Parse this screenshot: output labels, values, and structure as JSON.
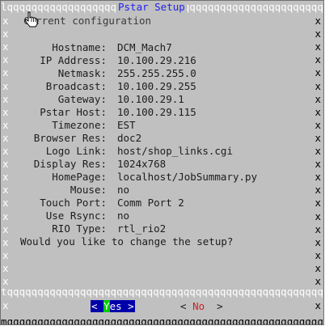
{
  "window": {
    "top_border": "lqqqqqqqqqqqqqqqqqqqqqqqqqqqqqqqqqqqqqqqqqqqqqqqqqqqqqqqqqqqqqqqqqqqqqqqqk",
    "title": "Pstar Setup",
    "subtitle": "Current configuration",
    "separator": "tqqqqqqqqqqqqqqqqqqqqqqqqqqqqqqqqqqqqqqqqqqqqqqqqqqqqqqqqqqqqqqqqqqqqqqqqqqu",
    "bottom_border": "mqqqqqqqqqqqqqqqqqqqqqqqqqqqqqqqqqqqqqqqqqqqqqqqqqqqqqqqqqqqqqqqqqqqqqqqqqqj",
    "side_char": "x"
  },
  "config": [
    {
      "label": "Hostname:",
      "value": "DCM_Mach7"
    },
    {
      "label": "IP Address:",
      "value": "10.100.29.216"
    },
    {
      "label": "Netmask:",
      "value": "255.255.255.0"
    },
    {
      "label": "Broadcast:",
      "value": "10.100.29.255"
    },
    {
      "label": "Gateway:",
      "value": "10.100.29.1"
    },
    {
      "label": "Pstar Host:",
      "value": "10.100.29.115"
    },
    {
      "label": "Timezone:",
      "value": "EST"
    },
    {
      "label": "Browser Res:",
      "value": "doc2"
    },
    {
      "label": "Logo Link:",
      "value": "host/shop_links.cgi"
    },
    {
      "label": "Display Res:",
      "value": "1024x768"
    },
    {
      "label": "HomePage:",
      "value": "localhost/JobSummary.py"
    },
    {
      "label": "Mouse:",
      "value": "no"
    },
    {
      "label": "Touch Port:",
      "value": "Comm Port 2"
    },
    {
      "label": "Use Rsync:",
      "value": "no"
    },
    {
      "label": "RIO Type:",
      "value": "rtl_rio2"
    }
  ],
  "question": "Would you like to change the setup?",
  "buttons": {
    "yes": {
      "open": "< ",
      "hot": "Y",
      "rest": "es",
      "close": " >"
    },
    "no": {
      "open": "< ",
      "hot": "No",
      "rest": "",
      "close": "  >"
    }
  },
  "colors": {
    "background": "#c0c0c0",
    "title": "#2222ee",
    "selected_button_bg": "#0000aa",
    "hotkey_selected": "#00cc00",
    "hotkey_no": "#cc2222"
  },
  "icons": {
    "cursor": "hand-pointer-icon"
  }
}
